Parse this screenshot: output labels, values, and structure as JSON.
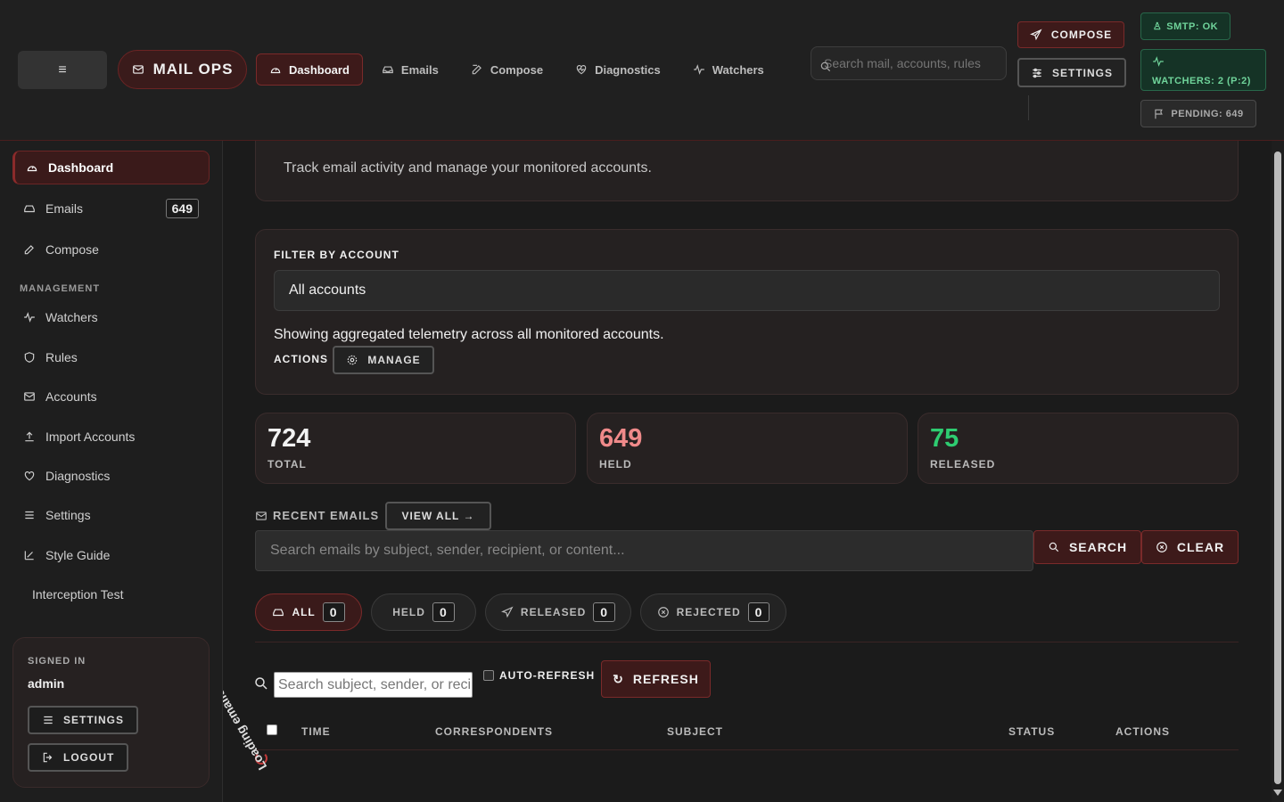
{
  "app": {
    "brand": "MAIL OPS"
  },
  "topbar": {
    "menu_icon": "≡",
    "nav": [
      {
        "label": "Dashboard",
        "icon": "gauge-icon"
      },
      {
        "label": "Emails",
        "icon": "inbox-icon"
      },
      {
        "label": "Compose",
        "icon": "edit-icon"
      },
      {
        "label": "Diagnostics",
        "icon": "heart-pulse-icon"
      },
      {
        "label": "Watchers",
        "icon": "activity-icon"
      }
    ],
    "search_placeholder": "Search mail, accounts, rules",
    "compose_label": "COMPOSE",
    "settings_label": "SETTINGS",
    "smtp_status": "SMTP: OK",
    "watchers_status": "WATCHERS: 2 (P:2)",
    "pending_status": "PENDING: 649"
  },
  "sidebar": {
    "items": [
      {
        "label": "Dashboard",
        "icon": "gauge-icon"
      },
      {
        "label": "Emails",
        "icon": "inbox-icon",
        "count": "649"
      },
      {
        "label": "Compose",
        "icon": "edit-icon"
      }
    ],
    "management_heading": "MANAGEMENT",
    "management": [
      {
        "label": "Watchers",
        "icon": "activity-icon"
      },
      {
        "label": "Rules",
        "icon": "shield-icon"
      },
      {
        "label": "Accounts",
        "icon": "envelope-icon"
      },
      {
        "label": "Import Accounts",
        "icon": "upload-icon"
      },
      {
        "label": "Diagnostics",
        "icon": "heart-pulse-icon"
      },
      {
        "label": "Settings",
        "icon": "sliders-icon"
      },
      {
        "label": "Style Guide",
        "icon": "brush-icon"
      },
      {
        "label": "Interception Test",
        "icon": ""
      }
    ],
    "signed_in_label": "SIGNED IN",
    "user": "admin",
    "settings_label": "SETTINGS",
    "logout_label": "LOGOUT"
  },
  "intro": {
    "text": "Track email activity and manage your monitored accounts."
  },
  "filter": {
    "label": "FILTER BY ACCOUNT",
    "selected": "All accounts",
    "note": "Showing aggregated telemetry across all monitored accounts.",
    "actions_label": "ACTIONS",
    "manage_label": "MANAGE"
  },
  "stats": [
    {
      "value": "724",
      "label": "TOTAL",
      "color": "#f2f2f2"
    },
    {
      "value": "649",
      "label": "HELD",
      "color": "#f08a8a"
    },
    {
      "value": "75",
      "label": "RELEASED",
      "color": "#2ecc71"
    }
  ],
  "recent": {
    "heading": "RECENT EMAILS",
    "view_all": "VIEW ALL →",
    "search_placeholder": "Search emails by subject, sender, recipient, or content...",
    "search_label": "SEARCH",
    "clear_label": "CLEAR",
    "tabs": [
      {
        "label": "ALL",
        "count": "0",
        "icon": "inbox-icon"
      },
      {
        "label": "HELD",
        "count": "0",
        "icon": ""
      },
      {
        "label": "RELEASED",
        "count": "0",
        "icon": "send-icon"
      },
      {
        "label": "REJECTED",
        "count": "0",
        "icon": "x-circle-icon"
      }
    ],
    "table_search_placeholder": "Search subject, sender, or recipient",
    "auto_refresh_label": "AUTO-REFRESH",
    "refresh_label": "REFRESH",
    "columns": [
      "TIME",
      "CORRESPONDENTS",
      "SUBJECT",
      "STATUS",
      "ACTIONS"
    ],
    "loading_text": "Loading emails"
  },
  "colors": {
    "accent": "#7a2a2a",
    "success": "#2ecc71",
    "held": "#f08a8a"
  }
}
